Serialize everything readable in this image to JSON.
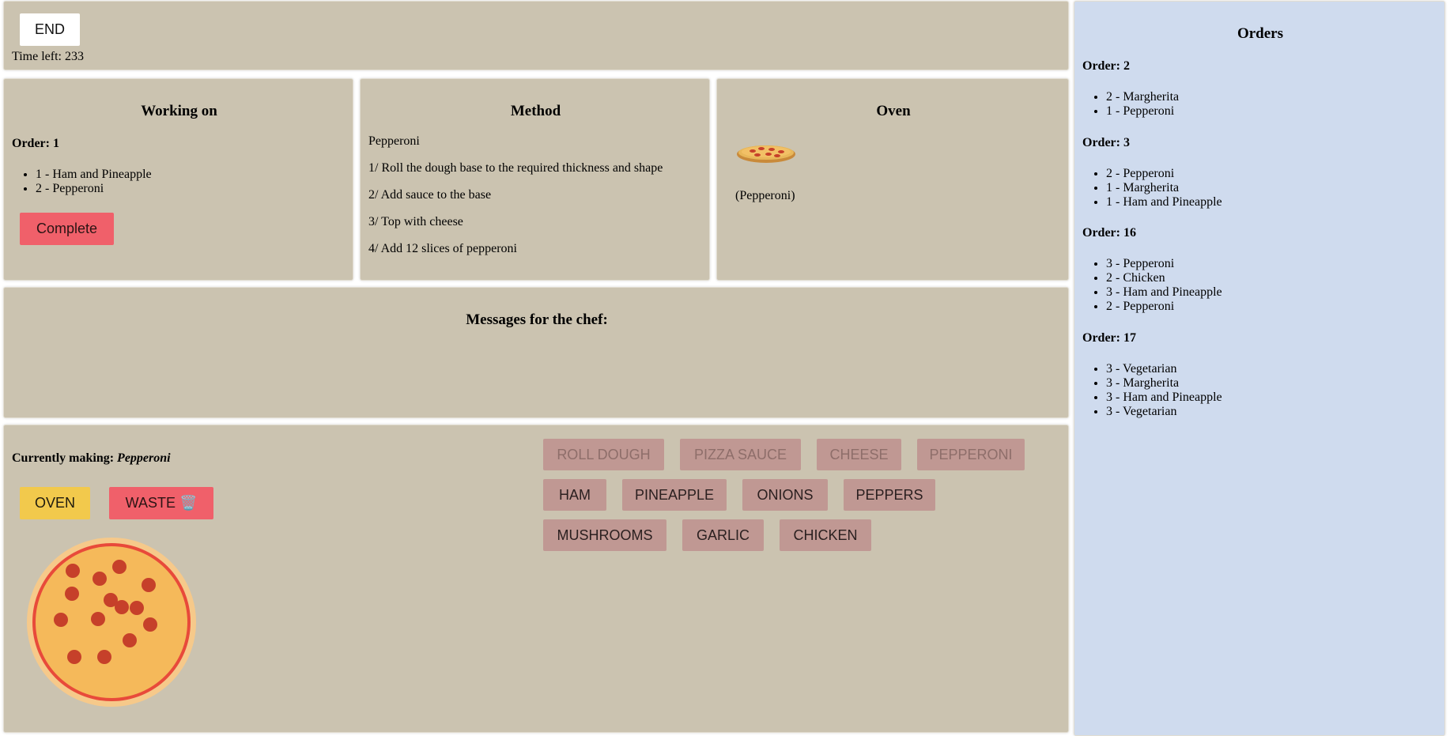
{
  "top": {
    "end_label": "END",
    "time_left": "Time left: 233"
  },
  "working_on": {
    "title": "Working on",
    "order_label": "Order: 1",
    "items": [
      "1 - Ham and Pineapple",
      "2 - Pepperoni"
    ],
    "complete_label": "Complete"
  },
  "method": {
    "title": "Method",
    "pizza_name": "Pepperoni",
    "steps": [
      "1/ Roll the dough base to the required thickness and shape",
      "2/ Add sauce to the base",
      "3/ Top with cheese",
      "4/ Add 12 slices of pepperoni"
    ]
  },
  "oven": {
    "title": "Oven",
    "icon": "pizza-icon",
    "caption": "(Pepperoni)"
  },
  "messages": {
    "title": "Messages for the chef:"
  },
  "making": {
    "prefix": "Currently making: ",
    "pizza": "Pepperoni",
    "oven_label": "OVEN",
    "waste_label": "WASTE 🗑️",
    "pepperoni_count": 14
  },
  "ingredients": {
    "row1": [
      "ROLL DOUGH",
      "PIZZA SAUCE",
      "CHEESE",
      "PEPPERONI"
    ],
    "row2": [
      "HAM",
      "PINEAPPLE",
      "ONIONS",
      "PEPPERS"
    ],
    "row3": [
      "MUSHROOMS",
      "GARLIC",
      "CHICKEN"
    ]
  },
  "orders": {
    "title": "Orders",
    "list": [
      {
        "label": "Order: 2",
        "items": [
          "2 - Margherita",
          "1 - Pepperoni"
        ]
      },
      {
        "label": "Order: 3",
        "items": [
          "2 - Pepperoni",
          "1 - Margherita",
          "1 - Ham and Pineapple"
        ]
      },
      {
        "label": "Order: 16",
        "items": [
          "3 - Pepperoni",
          "2 - Chicken",
          "3 - Ham and Pineapple",
          "2 - Pepperoni"
        ]
      },
      {
        "label": "Order: 17",
        "items": [
          "3 - Vegetarian",
          "3 - Margherita",
          "3 - Ham and Pineapple",
          "3 - Vegetarian"
        ]
      }
    ]
  },
  "colors": {
    "panel": "#cbc3b0",
    "orders_panel": "#cfdbee",
    "complete": "#f0606a",
    "oven": "#f2c94c",
    "waste": "#f0606a",
    "ingredient": "#c09893"
  }
}
